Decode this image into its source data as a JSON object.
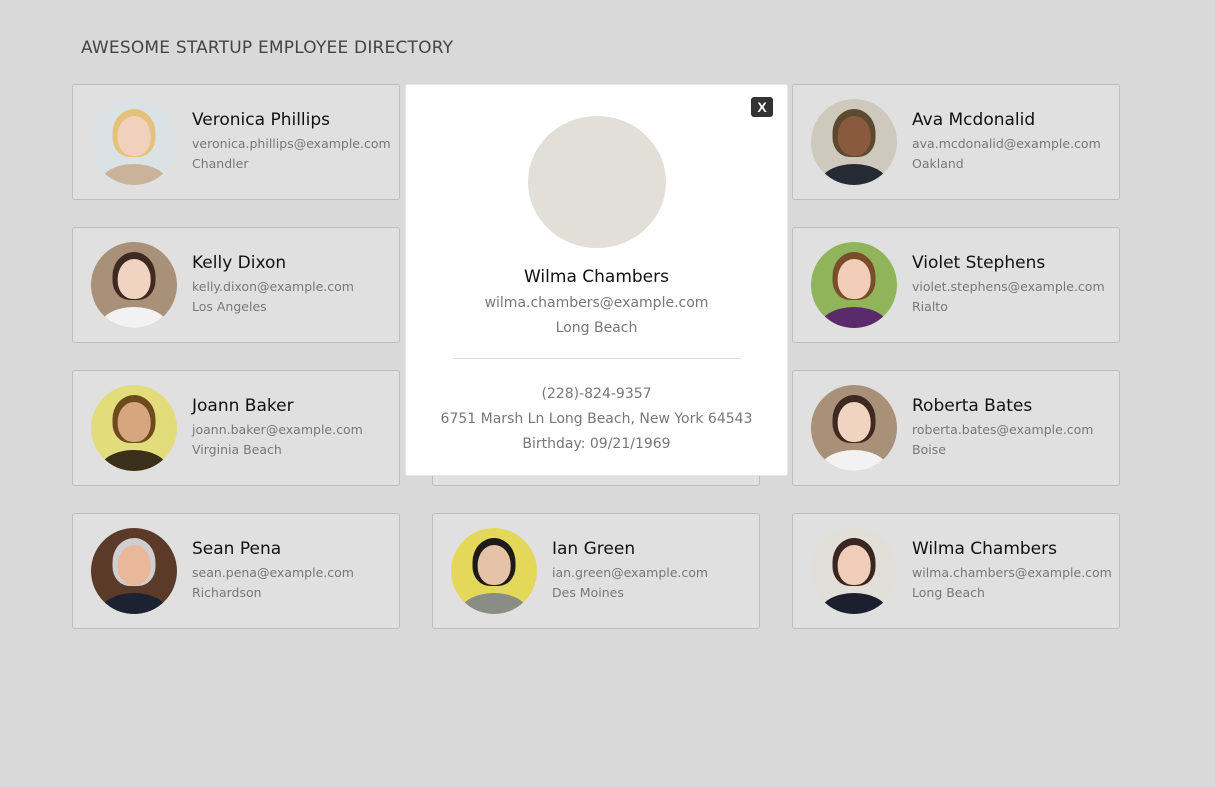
{
  "header": {
    "title": "AWESOME STARTUP EMPLOYEE DIRECTORY"
  },
  "employees": [
    {
      "name": "Veronica Phillips",
      "email": "veronica.phillips@example.com",
      "city": "Chandler",
      "colors": {
        "bg": "#dbe2e6",
        "hair": "#e5c27a",
        "skin": "#f1d1bd",
        "body": "#c9b49a"
      }
    },
    {
      "name": "Wilma Chambers",
      "email": "wilma.chambers@example.com",
      "city": "Long Beach",
      "colors": {
        "bg": "#e2ded8",
        "hair": "#3a2620",
        "skin": "#f0cdb8",
        "body": "#1c1f2e"
      }
    },
    {
      "name": "Ava Mcdonalid",
      "email": "ava.mcdonalid@example.com",
      "city": "Oakland",
      "colors": {
        "bg": "#cfc8bd",
        "hair": "#5c4a30",
        "skin": "#8a5a3e",
        "body": "#262a35"
      }
    },
    {
      "name": "Kelly Dixon",
      "email": "kelly.dixon@example.com",
      "city": "Los Angeles",
      "colors": {
        "bg": "#a89178",
        "hair": "#3e2a20",
        "skin": "#f0d3c0",
        "body": "#f2f2f2"
      }
    },
    {
      "name": "",
      "email": "",
      "city": "",
      "colors": {
        "bg": "#e0e0e0",
        "hair": "#e0e0e0",
        "skin": "#e0e0e0",
        "body": "#e0e0e0"
      }
    },
    {
      "name": "Violet Stephens",
      "email": "violet.stephens@example.com",
      "city": "Rialto",
      "colors": {
        "bg": "#8fb45a",
        "hair": "#7b4c2c",
        "skin": "#f2cdb7",
        "body": "#5b2a6a"
      }
    },
    {
      "name": "Joann Baker",
      "email": "joann.baker@example.com",
      "city": "Virginia Beach",
      "colors": {
        "bg": "#e2dc7a",
        "hair": "#6e4b1f",
        "skin": "#d6a77e",
        "body": "#3a2f1a"
      }
    },
    {
      "name": "",
      "email": "",
      "city": "",
      "colors": {
        "bg": "#e0e0e0",
        "hair": "#e0e0e0",
        "skin": "#e0e0e0",
        "body": "#e0e0e0"
      }
    },
    {
      "name": "Roberta Bates",
      "email": "roberta.bates@example.com",
      "city": "Boise",
      "colors": {
        "bg": "#a89178",
        "hair": "#3e2a20",
        "skin": "#f0d3c0",
        "body": "#f2f2f2"
      }
    },
    {
      "name": "Sean Pena",
      "email": "sean.pena@example.com",
      "city": "Richardson",
      "colors": {
        "bg": "#5b3a2a",
        "hair": "#cfcfcf",
        "skin": "#e9b79a",
        "body": "#1d2233"
      }
    },
    {
      "name": "Ian Green",
      "email": "ian.green@example.com",
      "city": "Des Moines",
      "colors": {
        "bg": "#e4d85a",
        "hair": "#1e1a18",
        "skin": "#e6c2a6",
        "body": "#8a8c86"
      }
    },
    {
      "name": "Wilma Chambers",
      "email": "wilma.chambers@example.com",
      "city": "Long Beach",
      "colors": {
        "bg": "#e2ded8",
        "hair": "#3a2620",
        "skin": "#f0cdb8",
        "body": "#1c1f2e"
      }
    }
  ],
  "modal": {
    "close_label": "X",
    "name": "Wilma Chambers",
    "email": "wilma.chambers@example.com",
    "city": "Long Beach",
    "phone": "(228)-824-9357",
    "address": "6751 Marsh Ln Long Beach, New York 64543",
    "birthday": "Birthday: 09/21/1969",
    "colors": {
      "bg": "#e2ded8",
      "hair": "#3a2620",
      "skin": "#f0cdb8",
      "body": "#1c1f2e"
    }
  }
}
